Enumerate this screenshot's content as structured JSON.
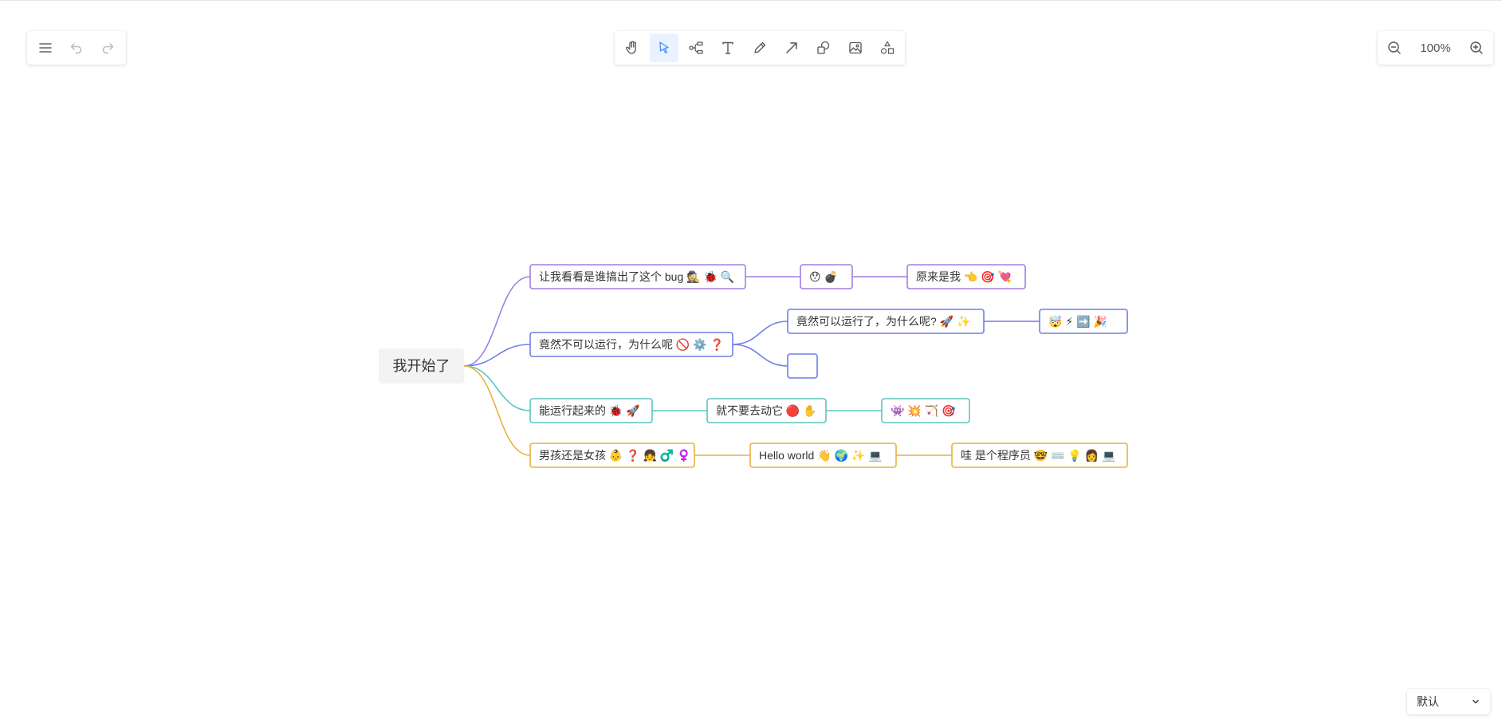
{
  "toolbar_left": {
    "menu_icon": "menu-icon",
    "undo_icon": "undo-icon",
    "redo_icon": "redo-icon"
  },
  "toolbar_main": {
    "tools": [
      "hand-icon",
      "pointer-icon",
      "mindmap-icon",
      "text-icon",
      "pen-icon",
      "arrow-icon",
      "shapes-icon",
      "image-icon",
      "more-shapes-icon"
    ],
    "active_tool": "pointer-icon"
  },
  "zoom": {
    "value": "100%"
  },
  "theme": {
    "value": "默认"
  },
  "colors": {
    "branch1": "#a07ee3",
    "branch2": "#6f7fe6",
    "branch3": "#5cc6c0",
    "branch4": "#e8b040",
    "root_bg": "#f3f3f3",
    "active_tool_bg": "#eaf2ff"
  },
  "mindmap": {
    "root": "我开始了",
    "nodes": {
      "b1": {
        "text": "让我看看是谁搞出了这个 bug",
        "emoji": [
          "🕵️",
          "🐞",
          "🔍"
        ]
      },
      "b1c": {
        "text": "",
        "emoji": [
          "😯",
          "💣"
        ]
      },
      "b1cc": {
        "text": "原来是我",
        "emoji": [
          "👈",
          "🎯",
          "💘"
        ]
      },
      "b2": {
        "text": "竟然不可以运行，为什么呢",
        "emoji": [
          "🚫",
          "⚙️",
          "❓"
        ]
      },
      "b2a": {
        "text": "竟然可以运行了，为什么呢?",
        "emoji": [
          "🚀",
          "✨"
        ]
      },
      "b2ac": {
        "text": "",
        "emoji": [
          "🤯",
          "⚡",
          "➡️",
          "🎉"
        ]
      },
      "b2b": {
        "text": "",
        "emoji": []
      },
      "b3": {
        "text": "能运行起来的",
        "emoji": [
          "🐞",
          "🚀"
        ]
      },
      "b3c": {
        "text": "就不要去动它",
        "emoji": [
          "🔴",
          "✋"
        ]
      },
      "b3cc": {
        "text": "",
        "emoji": [
          "👾",
          "💥",
          "🏹",
          "🎯"
        ]
      },
      "b4": {
        "text": "男孩还是女孩",
        "emoji": [
          "👶",
          "❓",
          "👧",
          "♂️",
          "♀️"
        ]
      },
      "b4c": {
        "text": "Hello world",
        "emoji": [
          "👋",
          "🌍",
          "✨",
          "💻"
        ]
      },
      "b4cc": {
        "text": "哇 是个程序员",
        "emoji": [
          "🤓",
          "⌨️",
          "💡",
          "👩",
          "💻"
        ]
      }
    }
  }
}
